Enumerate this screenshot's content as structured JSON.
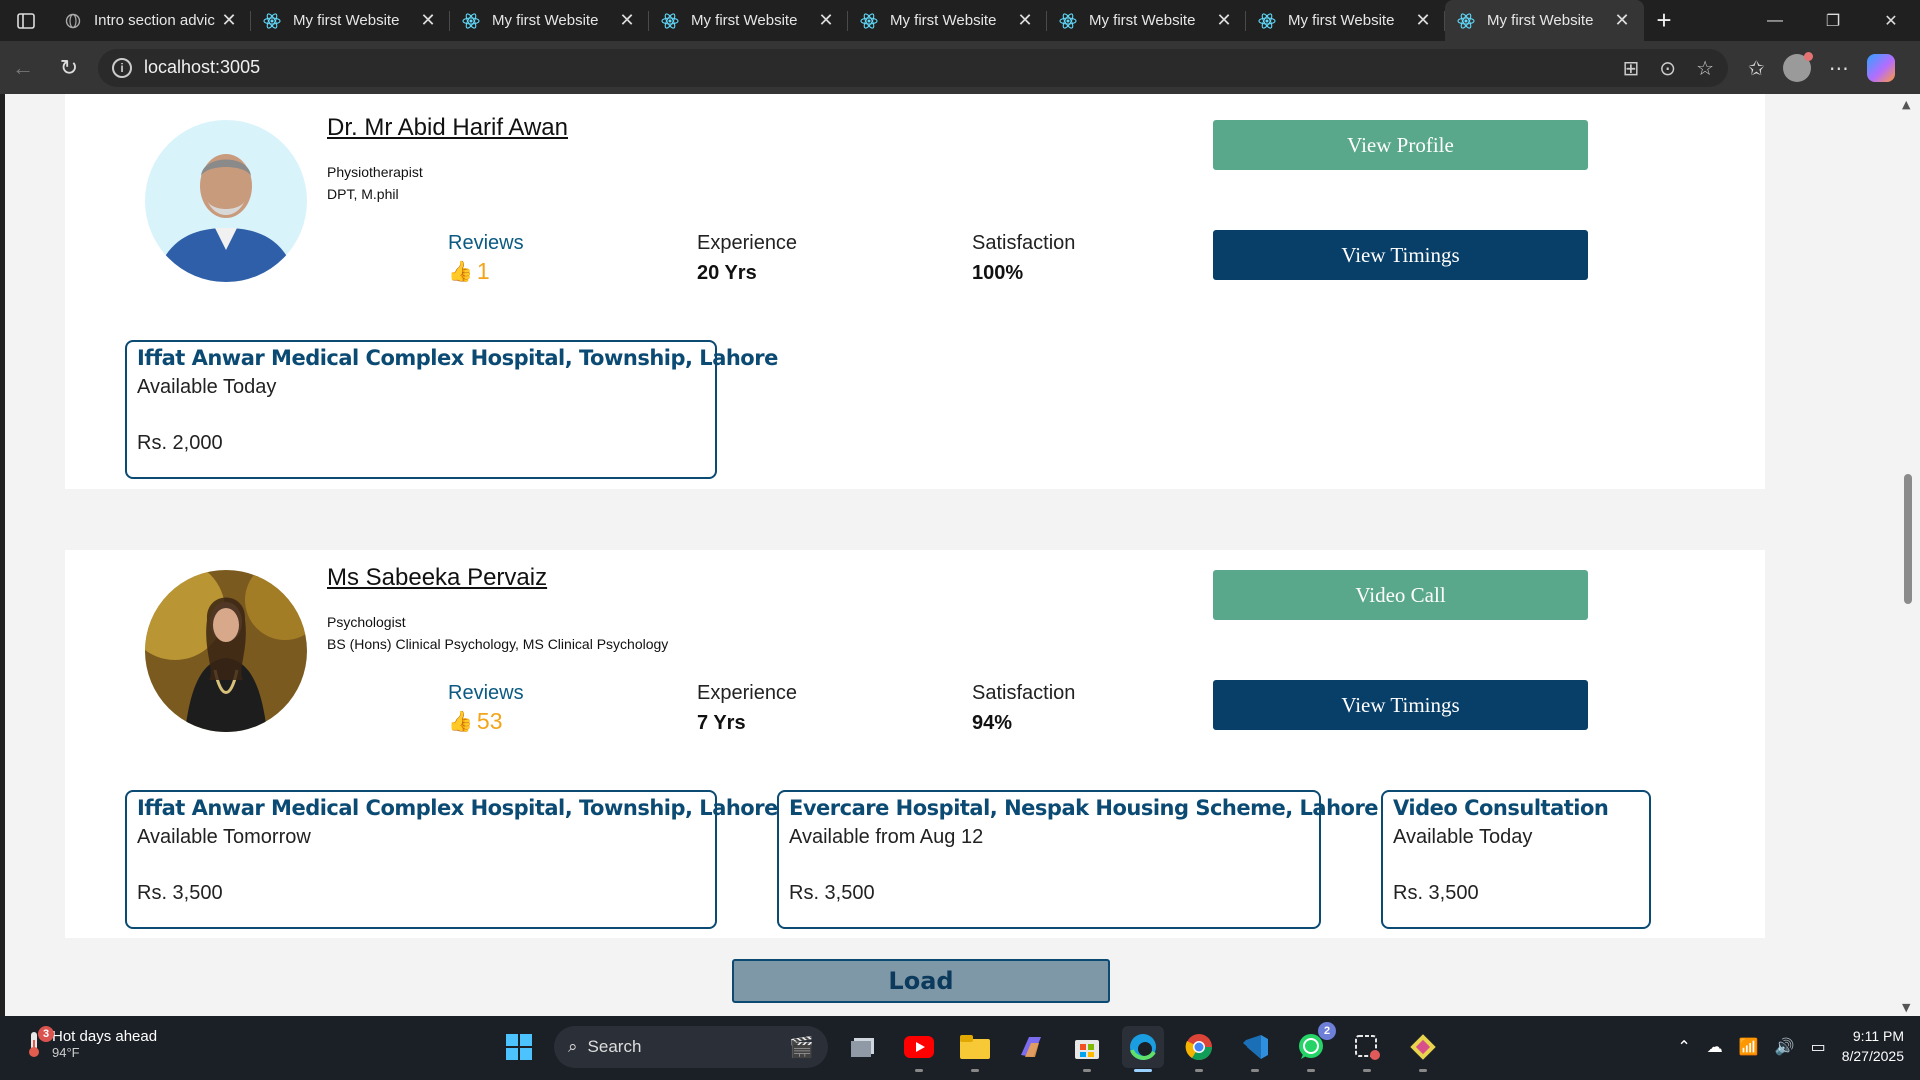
{
  "browser": {
    "tabs": [
      {
        "title": "Intro section advic",
        "icon": "globe-icon",
        "active": false
      },
      {
        "title": "My first Website",
        "icon": "react-icon",
        "active": false
      },
      {
        "title": "My first Website",
        "icon": "react-icon",
        "active": false
      },
      {
        "title": "My first Website",
        "icon": "react-icon",
        "active": false
      },
      {
        "title": "My first Website",
        "icon": "react-icon",
        "active": false
      },
      {
        "title": "My first Website",
        "icon": "react-icon",
        "active": false
      },
      {
        "title": "My first Website",
        "icon": "react-icon",
        "active": false
      },
      {
        "title": "My first Website",
        "icon": "react-icon",
        "active": true
      }
    ],
    "url": "localhost:3005"
  },
  "doctors": [
    {
      "name": "Dr. Mr Abid Harif Awan",
      "specialty": "Physiotherapist",
      "qualification": "DPT, M.phil",
      "reviews_label": "Reviews",
      "reviews": "1",
      "experience_label": "Experience",
      "experience": "20 Yrs",
      "satisfaction_label": "Satisfaction",
      "satisfaction": "100%",
      "primary_button": "View Profile",
      "timings_button": "View Timings",
      "locations": [
        {
          "name": "Iffat Anwar Medical Complex Hospital, Township, Lahore",
          "availability": "Available Today",
          "fee": "Rs. 2,000"
        }
      ]
    },
    {
      "name": "Ms Sabeeka Pervaiz",
      "specialty": "Psychologist",
      "qualification": "BS (Hons) Clinical Psychology, MS Clinical Psychology",
      "reviews_label": "Reviews",
      "reviews": "53",
      "experience_label": "Experience",
      "experience": "7 Yrs",
      "satisfaction_label": "Satisfaction",
      "satisfaction": "94%",
      "primary_button": "Video Call",
      "timings_button": "View Timings",
      "locations": [
        {
          "name": "Iffat Anwar Medical Complex Hospital, Township, Lahore",
          "availability": "Available Tomorrow",
          "fee": "Rs. 3,500"
        },
        {
          "name": "Evercare Hospital, Nespak Housing Scheme, Lahore",
          "availability": "Available from Aug 12",
          "fee": "Rs. 3,500"
        },
        {
          "name": "Video Consultation",
          "availability": "Available Today",
          "fee": "Rs. 3,500"
        }
      ]
    }
  ],
  "load_button": "Load",
  "taskbar": {
    "weather_title": "Hot days ahead",
    "weather_temp": "94°F",
    "weather_badge": "3",
    "search_label": "Search",
    "whatsapp_badge": "2",
    "time": "9:11 PM",
    "date": "8/27/2025"
  },
  "colors": {
    "accent_navy": "#073f69",
    "accent_green": "#5aa88c",
    "review_orange": "#f2a51a"
  }
}
